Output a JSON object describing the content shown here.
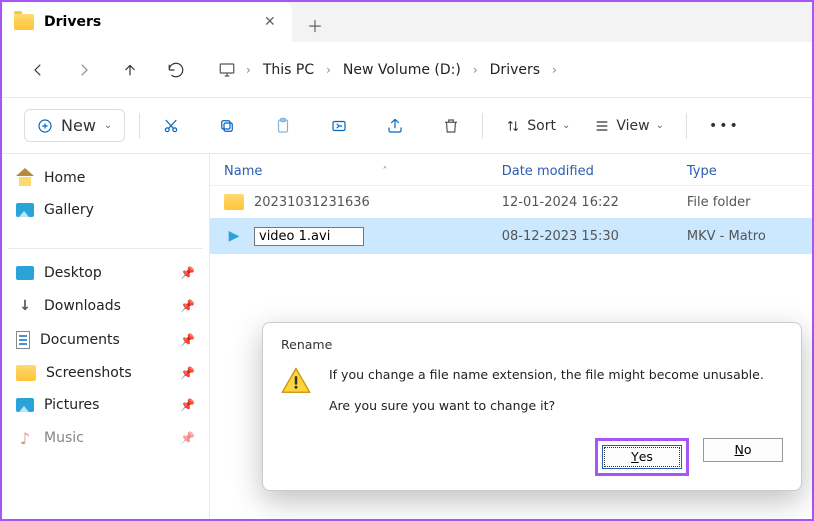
{
  "tab": {
    "title": "Drivers"
  },
  "breadcrumbs": [
    "This PC",
    "New Volume (D:)",
    "Drivers"
  ],
  "toolbar": {
    "new": "New",
    "sort": "Sort",
    "view": "View"
  },
  "sidebar": {
    "home": "Home",
    "gallery": "Gallery",
    "pinned": [
      "Desktop",
      "Downloads",
      "Documents",
      "Screenshots",
      "Pictures",
      "Music"
    ]
  },
  "columns": {
    "name": "Name",
    "date": "Date modified",
    "type": "Type"
  },
  "rows": [
    {
      "name": "20231031231636",
      "date": "12-01-2024 16:22",
      "type": "File folder",
      "kind": "folder"
    },
    {
      "name": "video 1.avi",
      "date": "08-12-2023 15:30",
      "type": "MKV - Matro",
      "kind": "video",
      "renaming": true
    }
  ],
  "dialog": {
    "title": "Rename",
    "line1": "If you change a file name extension, the file might become unusable.",
    "line2": "Are you sure you want to change it?",
    "yes": "Yes",
    "no": "No"
  }
}
